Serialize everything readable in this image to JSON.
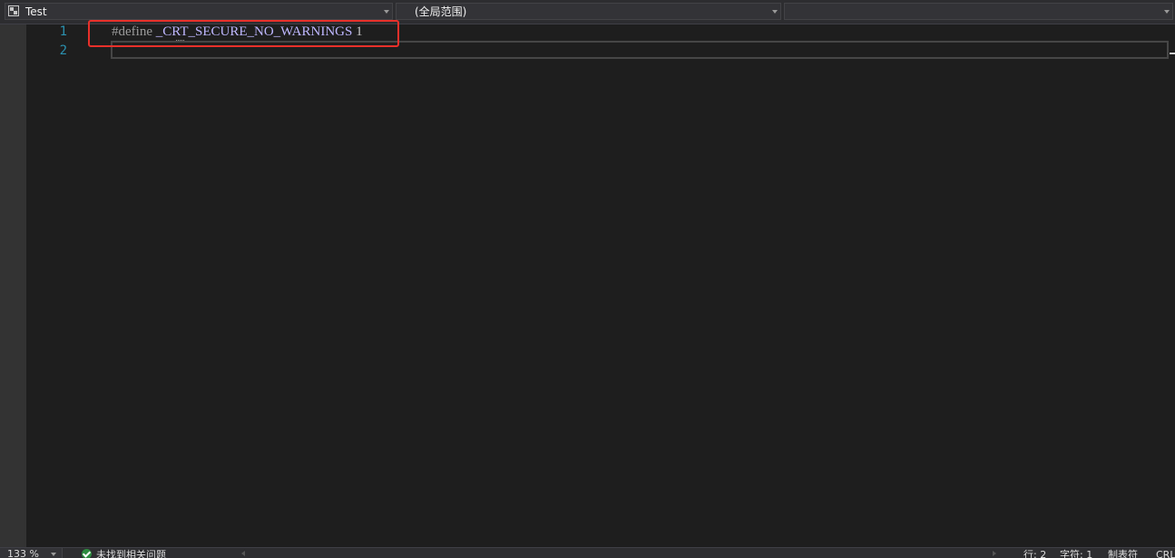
{
  "navbar": {
    "project": {
      "label": "Test",
      "icon": "project-icon"
    },
    "scope": {
      "label": "(全局范围)"
    },
    "member": {
      "label": ""
    }
  },
  "editor": {
    "lines": [
      {
        "number": "1",
        "tokens": {
          "directive": "#define",
          "space1": " ",
          "macro": "_CRT_SECURE_NO_WARNINGS",
          "space2": " ",
          "value": "1"
        }
      },
      {
        "number": "2",
        "text": ""
      }
    ],
    "colors": {
      "background": "#1e1e1e",
      "line_number": "#2b91af",
      "preprocessor": "#9b9b9b",
      "macro": "#beb7ff",
      "highlight": "#e8302a"
    }
  },
  "statusbar": {
    "zoom": "133 %",
    "issues": "未找到相关问题",
    "line": "行: 2",
    "char": "字符: 1",
    "tabs": "制表符",
    "eol": "CRL"
  }
}
